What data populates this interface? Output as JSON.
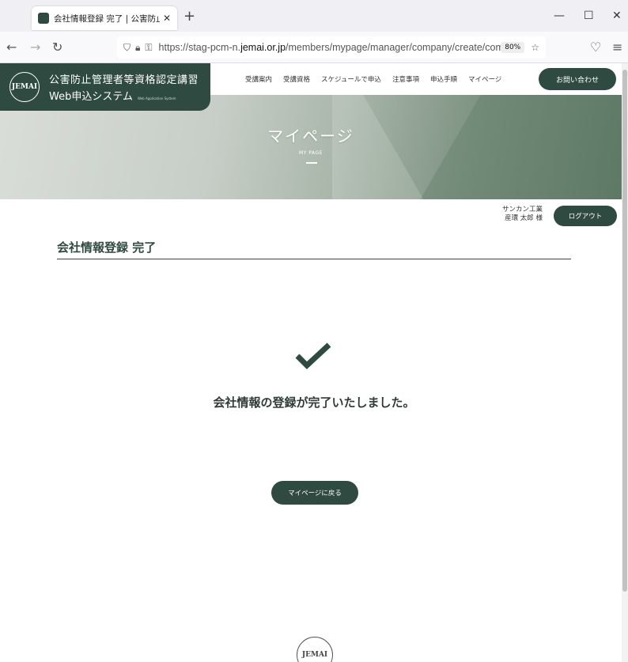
{
  "browser": {
    "tab_title": "会社情報登録 完了 | 公害防止管",
    "url_prefix": "https://stag-pcm-n.",
    "url_domain": "jemai.or.jp",
    "url_path": "/members/mypage/manager/company/create/com",
    "zoom": "80%"
  },
  "header": {
    "logo_mark": "JEMAI",
    "site_title_line1": "公害防止管理者等資格認定講習",
    "site_title_line2": "Web申込システム",
    "site_title_sub": "Web Application System",
    "nav": [
      "受講案内",
      "受講資格",
      "スケジュールで申込",
      "注意事項",
      "申込手順",
      "マイページ"
    ],
    "contact_label": "お問い合わせ"
  },
  "hero": {
    "title": "マイページ",
    "subtitle": "MY PAGE"
  },
  "user": {
    "company": "サンカン工業",
    "name": "産環 太郎 様",
    "logout_label": "ログアウト"
  },
  "main": {
    "section_title": "会社情報登録 完了",
    "message": "会社情報の登録が完了いたしました。",
    "back_label": "マイページに戻る"
  },
  "footer": {
    "logo_mark": "JEMAI"
  }
}
